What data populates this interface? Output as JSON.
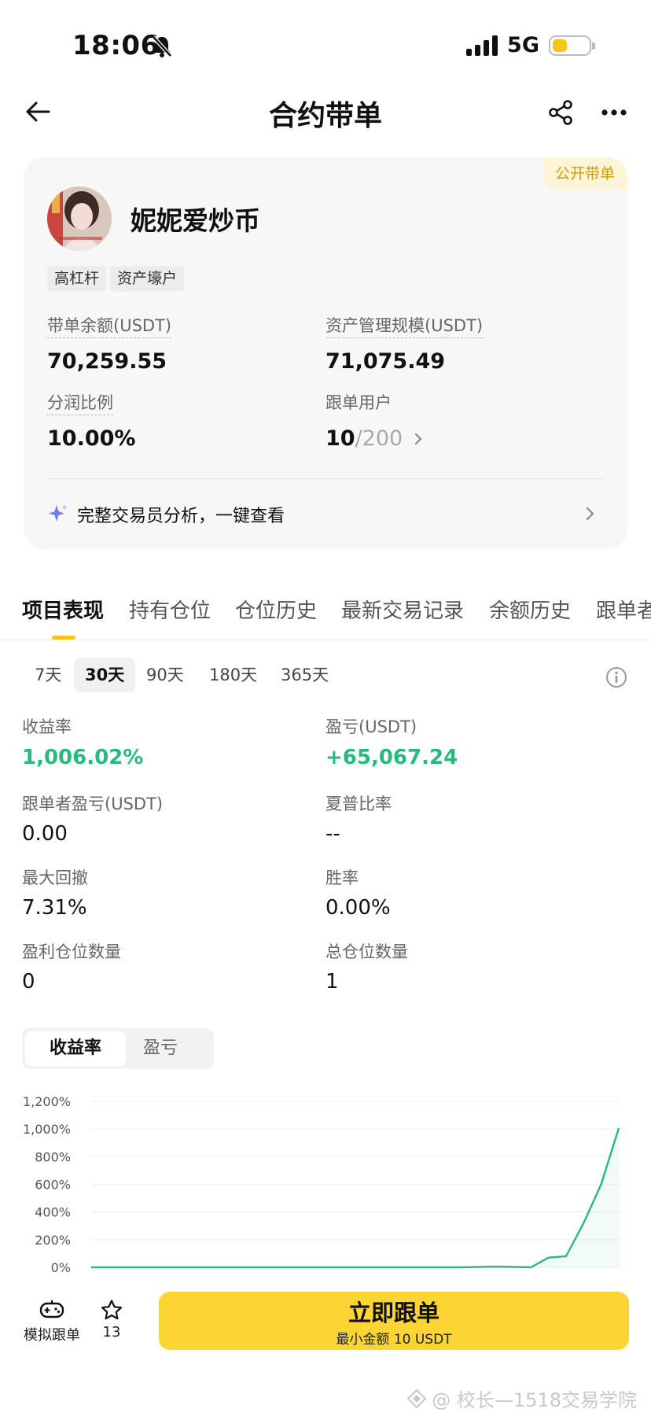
{
  "status_bar": {
    "time": "18:06",
    "network": "5G"
  },
  "header": {
    "title": "合约带单"
  },
  "card": {
    "badge": "公开带单",
    "name": "妮妮爱炒币",
    "tags": [
      "高杠杆",
      "资产壕户"
    ],
    "stats": {
      "balance_label": "带单余额(USDT)",
      "balance_value": "70,259.55",
      "aum_label": "资产管理规模(USDT)",
      "aum_value": "71,075.49",
      "profit_share_label": "分润比例",
      "profit_share_value": "10.00%",
      "followers_label": "跟单用户",
      "followers_current": "10",
      "followers_max": "/200"
    },
    "analysis_link": "完整交易员分析，一键查看"
  },
  "tabs": [
    "项目表现",
    "持有仓位",
    "仓位历史",
    "最新交易记录",
    "余额历史",
    "跟单者"
  ],
  "periods": [
    "7天",
    "30天",
    "90天",
    "180天",
    "365天"
  ],
  "active_period": "30天",
  "performance": {
    "roi_label": "收益率",
    "roi_value": "1,006.02%",
    "pnl_label": "盈亏(USDT)",
    "pnl_value": "+65,067.24",
    "follower_pnl_label": "跟单者盈亏(USDT)",
    "follower_pnl_value": "0.00",
    "sharpe_label": "夏普比率",
    "sharpe_value": "--",
    "mdd_label": "最大回撤",
    "mdd_value": "7.31%",
    "winrate_label": "胜率",
    "winrate_value": "0.00%",
    "win_positions_label": "盈利仓位数量",
    "win_positions_value": "0",
    "total_positions_label": "总仓位数量",
    "total_positions_value": "1"
  },
  "chart_toggle": [
    "收益率",
    "盈亏"
  ],
  "chart_data": {
    "type": "line",
    "y_ticks": [
      "1,200%",
      "1,000%",
      "800%",
      "600%",
      "400%",
      "200%",
      "0%"
    ],
    "ylim": [
      0,
      1200
    ],
    "x": [
      0,
      1,
      2,
      3,
      4,
      5,
      6,
      7,
      8,
      9,
      10,
      11,
      12,
      13,
      14,
      15,
      16,
      17,
      18,
      19,
      20,
      21,
      22,
      23,
      24,
      25,
      26,
      27,
      28,
      29
    ],
    "series": [
      {
        "values": [
          0,
          0,
          0,
          0,
          0,
          0,
          0,
          0,
          0,
          0,
          0,
          0,
          0,
          0,
          0,
          0,
          0,
          0,
          0,
          0,
          0,
          0,
          2,
          5,
          3,
          0,
          70,
          80,
          320,
          600,
          1006
        ]
      }
    ],
    "grid": true,
    "color": "#28b97d"
  },
  "bottom_bar": {
    "simulate_label": "模拟跟单",
    "favorites_count": "13",
    "follow_button": "立即跟单",
    "follow_min": "最小金额 10 USDT"
  },
  "watermark": "@ 校长—1518交易学院"
}
